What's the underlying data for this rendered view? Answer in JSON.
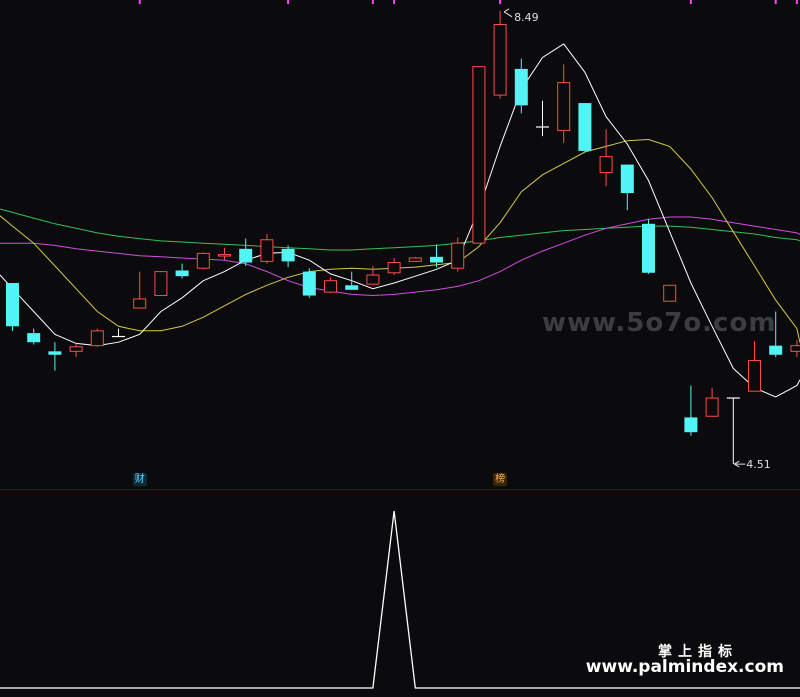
{
  "chart_data": [
    {
      "type": "candlestick",
      "title": "",
      "colors": {
        "up": "#ff4a4a",
        "down": "#53f4f5",
        "bg": "#0b0b0d",
        "ma5": "#ffffff",
        "ma10": "#d4c94a",
        "ma20": "#d04fe0",
        "ma60": "#33c15a",
        "marker": "#ff44ff"
      },
      "ylim": [
        4.3,
        8.55
      ],
      "annotations": {
        "high_label": "8.49",
        "low_label": "4.51"
      },
      "ohlc": [
        [
          6.1,
          6.1,
          5.68,
          5.72
        ],
        [
          5.66,
          5.7,
          5.56,
          5.58
        ],
        [
          5.5,
          5.58,
          5.33,
          5.47
        ],
        [
          5.5,
          5.57,
          5.45,
          5.54
        ],
        [
          5.55,
          5.7,
          5.54,
          5.68
        ],
        [
          5.63,
          5.7,
          5.63,
          5.63
        ],
        [
          5.88,
          6.2,
          5.88,
          5.96
        ],
        [
          5.99,
          6.2,
          5.99,
          6.2
        ],
        [
          6.21,
          6.27,
          6.14,
          6.16
        ],
        [
          6.23,
          6.37,
          6.22,
          6.36
        ],
        [
          6.34,
          6.41,
          6.3,
          6.35
        ],
        [
          6.4,
          6.49,
          6.25,
          6.28
        ],
        [
          6.29,
          6.53,
          6.27,
          6.48
        ],
        [
          6.4,
          6.43,
          6.24,
          6.29
        ],
        [
          6.2,
          6.23,
          5.97,
          5.99
        ],
        [
          6.02,
          6.15,
          6.01,
          6.12
        ],
        [
          6.08,
          6.2,
          6.04,
          6.04
        ],
        [
          6.09,
          6.25,
          6.09,
          6.17
        ],
        [
          6.19,
          6.32,
          6.17,
          6.28
        ],
        [
          6.29,
          6.33,
          6.29,
          6.32
        ],
        [
          6.33,
          6.44,
          6.24,
          6.28
        ],
        [
          6.23,
          6.5,
          6.2,
          6.45
        ],
        [
          6.45,
          8.0,
          6.45,
          8.0
        ],
        [
          7.75,
          8.49,
          7.72,
          8.37
        ],
        [
          7.98,
          8.07,
          7.59,
          7.66
        ],
        [
          7.47,
          7.7,
          7.39,
          7.47
        ],
        [
          7.44,
          8.02,
          7.33,
          7.86
        ],
        [
          7.68,
          7.68,
          7.25,
          7.26
        ],
        [
          7.07,
          7.45,
          6.95,
          7.21
        ],
        [
          7.14,
          7.14,
          6.74,
          6.89
        ],
        [
          6.62,
          6.66,
          6.18,
          6.19
        ],
        [
          5.94,
          6.08,
          5.94,
          6.08
        ],
        [
          4.92,
          5.2,
          4.76,
          4.79
        ],
        [
          4.93,
          5.18,
          4.93,
          5.09
        ],
        [
          5.09,
          5.09,
          4.51,
          5.09
        ],
        [
          5.15,
          5.59,
          5.15,
          5.42
        ],
        [
          5.55,
          5.85,
          5.45,
          5.47
        ],
        [
          5.5,
          5.6,
          5.45,
          5.55
        ]
      ],
      "ma5": [
        6.05,
        5.85,
        5.65,
        5.57,
        5.55,
        5.58,
        5.65,
        5.85,
        5.97,
        6.12,
        6.2,
        6.3,
        6.36,
        6.37,
        6.3,
        6.18,
        6.12,
        6.05,
        6.1,
        6.16,
        6.22,
        6.3,
        6.75,
        7.3,
        7.8,
        8.08,
        8.2,
        7.95,
        7.56,
        7.32,
        7.0,
        6.55,
        6.1,
        5.72,
        5.35,
        5.18,
        5.1,
        5.2
      ],
      "ma10": [
        6.6,
        6.45,
        6.25,
        6.05,
        5.85,
        5.72,
        5.68,
        5.68,
        5.72,
        5.8,
        5.9,
        6.0,
        6.08,
        6.15,
        6.2,
        6.22,
        6.23,
        6.22,
        6.23,
        6.24,
        6.26,
        6.28,
        6.42,
        6.63,
        6.9,
        7.05,
        7.15,
        7.25,
        7.3,
        7.35,
        7.36,
        7.3,
        7.1,
        6.85,
        6.55,
        6.25,
        5.95,
        5.7
      ],
      "ma20": [
        6.45,
        6.45,
        6.43,
        6.4,
        6.38,
        6.36,
        6.34,
        6.33,
        6.32,
        6.31,
        6.3,
        6.27,
        6.2,
        6.12,
        6.06,
        6.03,
        6.0,
        5.99,
        6.0,
        6.02,
        6.04,
        6.07,
        6.12,
        6.2,
        6.3,
        6.38,
        6.45,
        6.52,
        6.58,
        6.62,
        6.66,
        6.68,
        6.68,
        6.66,
        6.63,
        6.6,
        6.57,
        6.54
      ],
      "ma60": [
        6.72,
        6.67,
        6.62,
        6.58,
        6.54,
        6.51,
        6.49,
        6.47,
        6.46,
        6.45,
        6.44,
        6.43,
        6.42,
        6.41,
        6.4,
        6.39,
        6.39,
        6.4,
        6.41,
        6.42,
        6.43,
        6.45,
        6.47,
        6.5,
        6.52,
        6.54,
        6.56,
        6.57,
        6.58,
        6.59,
        6.6,
        6.6,
        6.59,
        6.57,
        6.55,
        6.53,
        6.5,
        6.48
      ],
      "markers": [
        {
          "index": 6,
          "label": "财",
          "style": "blue"
        },
        {
          "index": 23,
          "label": "榜",
          "style": "orange"
        }
      ],
      "top_tick_marks_at": [
        6,
        13,
        17,
        18,
        23,
        32,
        36,
        37
      ]
    },
    {
      "type": "line",
      "title": "",
      "ylim": [
        0,
        1
      ],
      "values": [
        0,
        0,
        0,
        0,
        0,
        0,
        0,
        0,
        0,
        0,
        0,
        0,
        0,
        0,
        0,
        0,
        0,
        0,
        1,
        0,
        0,
        0,
        0,
        0,
        0,
        0,
        0,
        0,
        0,
        0,
        0,
        0,
        0,
        0,
        0,
        0,
        0,
        0
      ],
      "color": "#ffffff"
    }
  ],
  "overlay": {
    "watermark": "www.5o7o.com",
    "corner_title": "掌上指标",
    "corner_url": "www.palmindex.com"
  }
}
